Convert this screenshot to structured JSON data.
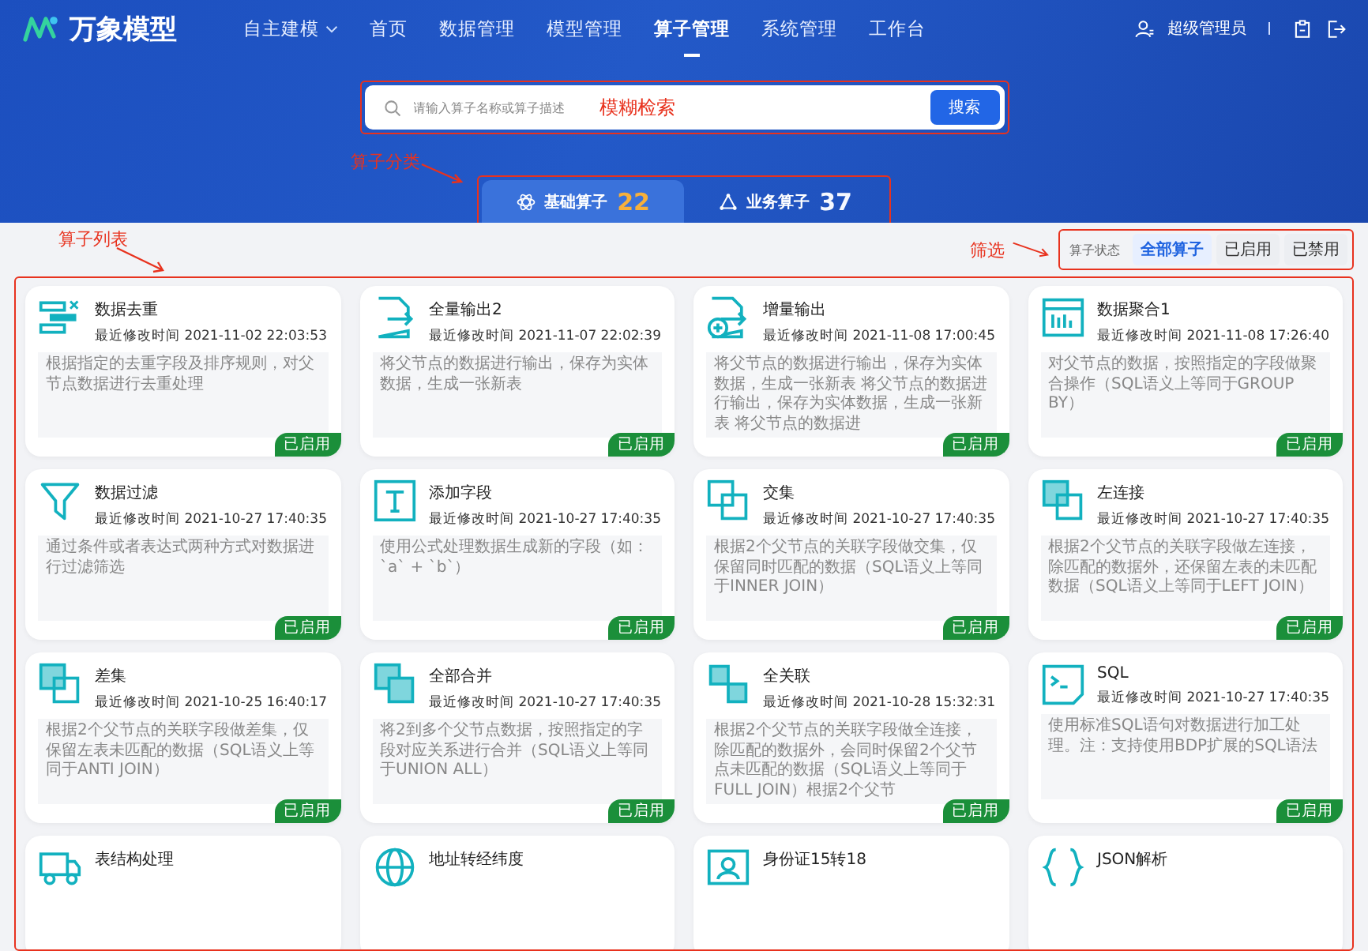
{
  "logo": {
    "text": "万象模型"
  },
  "nav": [
    {
      "label": "自主建模",
      "selected": false,
      "dropdown": true
    },
    {
      "label": "首页",
      "selected": false,
      "dropdown": false
    },
    {
      "label": "数据管理",
      "selected": false,
      "dropdown": false
    },
    {
      "label": "模型管理",
      "selected": false,
      "dropdown": false
    },
    {
      "label": "算子管理",
      "selected": true,
      "dropdown": false
    },
    {
      "label": "系统管理",
      "selected": false,
      "dropdown": false
    },
    {
      "label": "工作台",
      "selected": false,
      "dropdown": false
    }
  ],
  "user": {
    "name": "超级管理员"
  },
  "search": {
    "placeholder": "请输入算子名称或算子描述",
    "button": "搜索",
    "annotation": "模糊检索"
  },
  "category_annotation": "算子分类",
  "tabs": [
    {
      "label": "基础算子",
      "count": "22",
      "selected": true
    },
    {
      "label": "业务算子",
      "count": "37",
      "selected": false
    }
  ],
  "list_annotation": "算子列表",
  "filter": {
    "annotation": "筛选",
    "label": "算子状态",
    "options": [
      {
        "label": "全部算子",
        "selected": true
      },
      {
        "label": "已启用",
        "selected": false
      },
      {
        "label": "已禁用",
        "selected": false
      }
    ]
  },
  "operators": [
    {
      "name": "数据去重",
      "time": "最近修改时间 2021-11-02 22:03:53",
      "description": "根据指定的去重字段及排序规则，对父节点数据进行去重处理",
      "status": "已启用",
      "enabled": true
    },
    {
      "name": "全量输出2",
      "time": "最近修改时间 2021-11-07 22:02:39",
      "description": "将父节点的数据进行输出，保存为实体数据，生成一张新表",
      "status": "已启用",
      "enabled": true
    },
    {
      "name": "增量输出",
      "time": "最近修改时间 2021-11-08 17:00:45",
      "description": "将父节点的数据进行输出，保存为实体数据，生成一张新表 将父节点的数据进行输出，保存为实体数据，生成一张新表 将父节点的数据进",
      "status": "已启用",
      "enabled": true
    },
    {
      "name": "数据聚合1",
      "time": "最近修改时间 2021-11-08 17:26:40",
      "description": "对父节点的数据，按照指定的字段做聚合操作（SQL语义上等同于GROUP BY）",
      "status": "已启用",
      "enabled": true
    },
    {
      "name": "数据过滤",
      "time": "最近修改时间 2021-10-27 17:40:35",
      "description": "通过条件或者表达式两种方式对数据进行过滤筛选",
      "status": "已启用",
      "enabled": true
    },
    {
      "name": "添加字段",
      "time": "最近修改时间 2021-10-27 17:40:35",
      "description": "使用公式处理数据生成新的字段（如：`a` + `b`）",
      "status": "已启用",
      "enabled": true
    },
    {
      "name": "交集",
      "time": "最近修改时间 2021-10-27 17:40:35",
      "description": "根据2个父节点的关联字段做交集，仅保留同时匹配的数据（SQL语义上等同于INNER JOIN）",
      "status": "已启用",
      "enabled": true
    },
    {
      "name": "左连接",
      "time": "最近修改时间 2021-10-27 17:40:35",
      "description": "根据2个父节点的关联字段做左连接，除匹配的数据外，还保留左表的未匹配数据（SQL语义上等同于LEFT JOIN）",
      "status": "已启用",
      "enabled": true
    },
    {
      "name": "差集",
      "time": "最近修改时间 2021-10-25 16:40:17",
      "description": "根据2个父节点的关联字段做差集，仅保留左表未匹配的数据（SQL语义上等同于ANTI JOIN）",
      "status": "已启用",
      "enabled": true
    },
    {
      "name": "全部合并",
      "time": "最近修改时间 2021-10-27 17:40:35",
      "description": "将2到多个父节点数据，按照指定的字段对应关系进行合并（SQL语义上等同于UNION ALL）",
      "status": "已启用",
      "enabled": true
    },
    {
      "name": "全关联",
      "time": "最近修改时间 2021-10-28 15:32:31",
      "description": "根据2个父节点的关联字段做全连接，除匹配的数据外，会同时保留2个父节点未匹配的数据（SQL语义上等同于FULL JOIN）根据2个父节",
      "status": "已启用",
      "enabled": true
    },
    {
      "name": "SQL",
      "time": "最近修改时间 2021-10-27 17:40:35",
      "description": "使用标准SQL语句对数据进行加工处理。注：支持使用BDP扩展的SQL语法",
      "status": "已启用",
      "enabled": true
    },
    {
      "name": "表结构处理"
    },
    {
      "name": "地址转经纬度"
    },
    {
      "name": "身份证15转18"
    },
    {
      "name": "JSON解析"
    }
  ]
}
